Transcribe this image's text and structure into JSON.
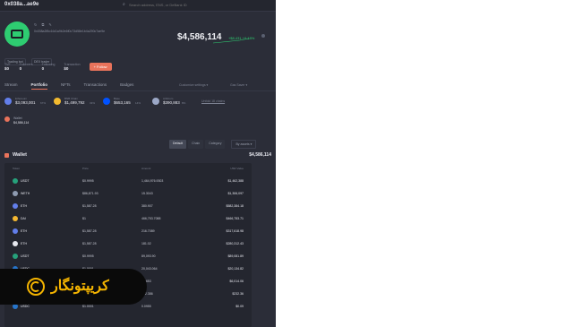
{
  "header": {
    "address": "0x038a...ae9e",
    "search_placeholder": "Search address, ENS, or DeBank ID"
  },
  "profile": {
    "icons": "↻ ⧉ ✎",
    "full_address": "0x038a2f8c44d1a9b2e6f0c73d58e1b4a290c7ae9e",
    "net_worth": "$4,586,114",
    "change": "+$8,431 +0.18%"
  },
  "tags": [
    "Trading bot",
    "DEX trader"
  ],
  "stats": [
    {
      "label": "TVF",
      "value": "$0"
    },
    {
      "label": "Followers",
      "value": "0"
    },
    {
      "label": "Following",
      "value": "0"
    },
    {
      "label": "Transaction",
      "value": "$0"
    }
  ],
  "follow_label": "+ Follow",
  "tabs": [
    {
      "label": "Stream",
      "active": false
    },
    {
      "label": "Portfolio",
      "active": true
    },
    {
      "label": "NFTs",
      "active": false
    },
    {
      "label": "Transactions",
      "active": false
    },
    {
      "label": "Badges",
      "active": false
    }
  ],
  "tabs_right": [
    "Customize settings ▾",
    "Gas Saver ▾"
  ],
  "chains": [
    {
      "name": "Ethereum",
      "value": "$3,093,001",
      "pct": "67%",
      "color": "#627eea"
    },
    {
      "name": "BNB Chain",
      "value": "$1,499,792",
      "pct": "33%",
      "color": "#f3ba2f"
    },
    {
      "name": "Base",
      "value": "$653,165",
      "pct": "14%",
      "color": "#0052ff"
    },
    {
      "name": "Arbitrum",
      "value": "$390,883",
      "pct": "8%",
      "color": "#9ba7c6"
    }
  ],
  "unfold_label": "Unfold 18 chains",
  "bnb_chip": {
    "name": "Wallet",
    "value": "$4,586,114"
  },
  "filters": [
    "Default",
    "Chain",
    "Category"
  ],
  "filter_select": "By assets ▾",
  "wallet": {
    "title": "Wallet",
    "total": "$4,586,114"
  },
  "table_headers": {
    "token": "Token",
    "price": "Price",
    "amount": "Amount",
    "usd": "USD Value"
  },
  "tokens": [
    {
      "symbol": "USDT",
      "price": "$0.9995",
      "amount": "1,464,976.9303",
      "value": "$1,462,388",
      "color": "#26a17b"
    },
    {
      "symbol": "WETH",
      "price": "$86,871.93",
      "amount": "15.3043",
      "value": "$1,306,097",
      "color": "#8e9ab0"
    },
    {
      "symbol": "ETH",
      "price": "$1,587.28",
      "amount": "380.907",
      "value": "$582,384.18",
      "color": "#627eea"
    },
    {
      "symbol": "DAI",
      "price": "$1",
      "amount": "466,753.7088",
      "value": "$466,753.71",
      "color": "#f4b731"
    },
    {
      "symbol": "ETH",
      "price": "$1,587.28",
      "amount": "216.7089",
      "value": "$317,618.98",
      "color": "#627eea"
    },
    {
      "symbol": "ETH",
      "price": "$1,587.28",
      "amount": "181.02",
      "value": "$280,312.43",
      "color": "#e6e7ee"
    },
    {
      "symbol": "USDT",
      "price": "$0.9995",
      "amount": "89,093.90",
      "value": "$89,081.89",
      "color": "#26a17b"
    },
    {
      "symbol": "USDC",
      "price": "$1.0001",
      "amount": "20,043.064",
      "value": "$20,134.82",
      "color": "#2775ca"
    },
    {
      "symbol": "BNB",
      "price": "$600.91",
      "amount": "1.0653",
      "value": "$6,014.06",
      "color": "#f3ba2f"
    },
    {
      "symbol": "DAI",
      "price": "$1",
      "amount": "232.386",
      "value": "$232.36",
      "color": "#f4b731"
    },
    {
      "symbol": "USDC",
      "price": "$1.0001",
      "amount": "0.0955",
      "value": "$0.09",
      "color": "#2775ca"
    }
  ],
  "banner": {
    "text": "کریپتونگار"
  }
}
